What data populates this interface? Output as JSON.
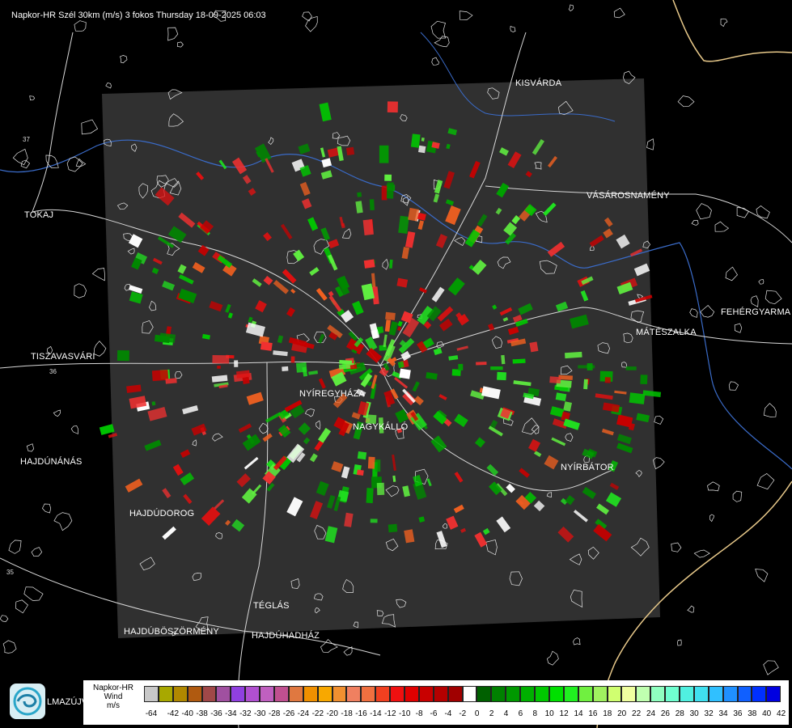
{
  "header": {
    "title": "Napkor-HR Szél 30km (m/s) 3 fokos Thursday 18-09-2025 06:03"
  },
  "cities": [
    "KISVÁRDA",
    "VÁSÁROSNAMÉNY",
    "TOKAJ",
    "FEHÉRGYARMA",
    "MÁTÉSZALKA",
    "TISZAVASVÁRI",
    "NYÍREGYHÁZA",
    "NAGYKÁLLÓ",
    "HAJDÚNÁNÁS",
    "NYÍRBÁTOR",
    "HAJDÚDOROG",
    "TÉGLÁS",
    "HAJDÚBÖSZÖRMÉNY",
    "HAJDÚHADHÁZ",
    "LMAZÚJVÁR"
  ],
  "roads": [
    "36",
    "35",
    "37"
  ],
  "legend": {
    "line1": "Napkor-HR",
    "line2": "Wind",
    "line3": "m/s",
    "ticks": [
      "-64",
      "-42",
      "-40",
      "-38",
      "-36",
      "-34",
      "-32",
      "-30",
      "-28",
      "-26",
      "-24",
      "-22",
      "-20",
      "-18",
      "-16",
      "-14",
      "-12",
      "-10",
      "-8",
      "-6",
      "-4",
      "-2",
      "0",
      "2",
      "4",
      "6",
      "8",
      "10",
      "12",
      "14",
      "16",
      "18",
      "20",
      "22",
      "24",
      "26",
      "28",
      "30",
      "32",
      "34",
      "36",
      "38",
      "40",
      "42"
    ],
    "colors": [
      "#c8c8c8",
      "#a8a800",
      "#b08800",
      "#b05a10",
      "#a04848",
      "#a050a0",
      "#9040e0",
      "#b050d0",
      "#c060c0",
      "#c05090",
      "#e07840",
      "#f09000",
      "#f8a800",
      "#f09030",
      "#f08060",
      "#f07040",
      "#f04020",
      "#f01010",
      "#e00000",
      "#c80000",
      "#b40000",
      "#a00000",
      "#ffffff",
      "#006000",
      "#008000",
      "#009800",
      "#00b000",
      "#00c800",
      "#00e000",
      "#20f020",
      "#70f040",
      "#a0f060",
      "#d0ff70",
      "#f0ffa0",
      "#c0ffb0",
      "#90ffc0",
      "#70ffd0",
      "#50f0e0",
      "#40e0f0",
      "#30c0ff",
      "#2090ff",
      "#1060ff",
      "#0030ff",
      "#0000e0"
    ]
  }
}
